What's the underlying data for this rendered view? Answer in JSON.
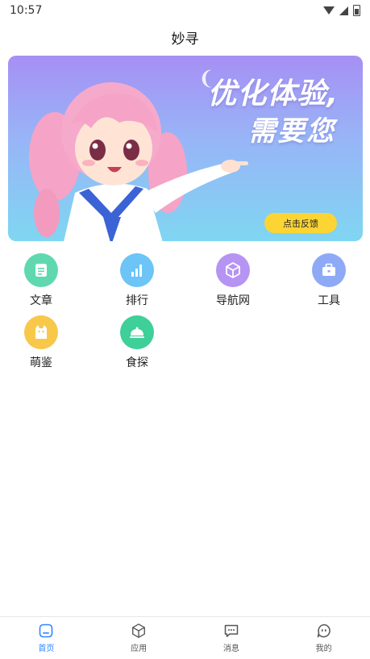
{
  "status_bar": {
    "time": "10:57"
  },
  "header": {
    "title": "妙寻"
  },
  "banner": {
    "headline_line1": "优化体验,",
    "headline_line2": "需要您",
    "button_label": "点击反馈"
  },
  "grid": [
    {
      "label": "文章",
      "icon": "document-icon",
      "color": "#5fd8b0"
    },
    {
      "label": "排行",
      "icon": "bar-chart-icon",
      "color": "#6cc4f7"
    },
    {
      "label": "导航网",
      "icon": "cube-icon",
      "color": "#b694f3"
    },
    {
      "label": "工具",
      "icon": "toolbox-icon",
      "color": "#8eaaf6"
    },
    {
      "label": "萌鉴",
      "icon": "cat-icon",
      "color": "#f8c84a"
    },
    {
      "label": "食探",
      "icon": "food-cloche-icon",
      "color": "#3fcf98"
    }
  ],
  "bottom_nav": [
    {
      "label": "首页",
      "icon": "home-icon",
      "active": true
    },
    {
      "label": "应用",
      "icon": "cube-icon",
      "active": false
    },
    {
      "label": "消息",
      "icon": "message-icon",
      "active": false
    },
    {
      "label": "我的",
      "icon": "profile-icon",
      "active": false
    }
  ],
  "colors": {
    "accent": "#2f86ff",
    "feedback_button": "#fcd535"
  }
}
